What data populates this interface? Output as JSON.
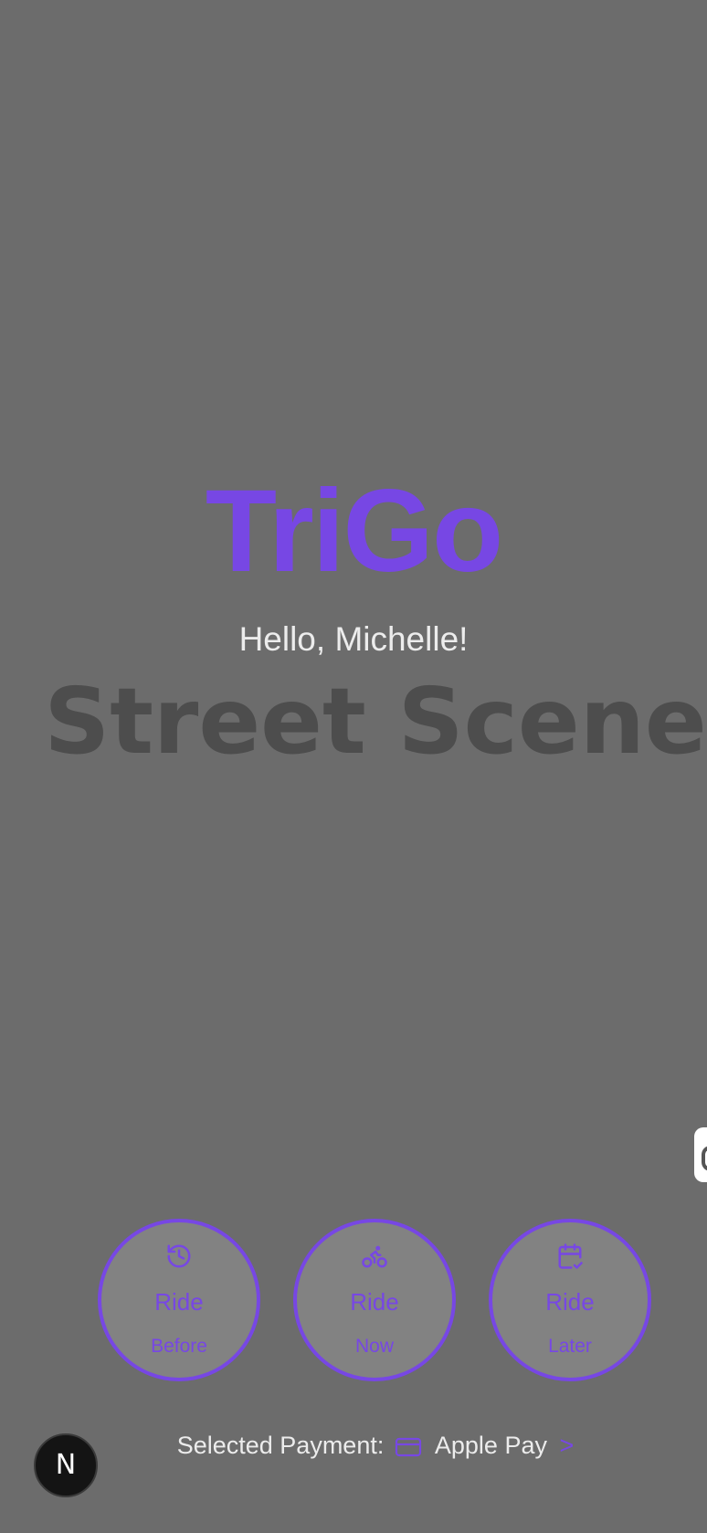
{
  "app": {
    "name": "TriGo",
    "greeting": "Hello, Michelle!",
    "background_text": "Street Scene"
  },
  "rides": [
    {
      "label": "Ride",
      "sub": "Before",
      "icon": "history-icon"
    },
    {
      "label": "Ride",
      "sub": "Now",
      "icon": "bicycle-icon"
    },
    {
      "label": "Ride",
      "sub": "Later",
      "icon": "calendar-check-icon"
    }
  ],
  "payment": {
    "prefix": "Selected Payment:",
    "method": "Apple Pay",
    "chevron": ">",
    "icon": "credit-card-icon"
  },
  "badge": {
    "letter": "N"
  },
  "colors": {
    "accent": "#7747e4",
    "background": "#6c6c6c",
    "button_fill": "#828282",
    "text_light": "#ececec",
    "watermark": "#4d4d4d"
  }
}
